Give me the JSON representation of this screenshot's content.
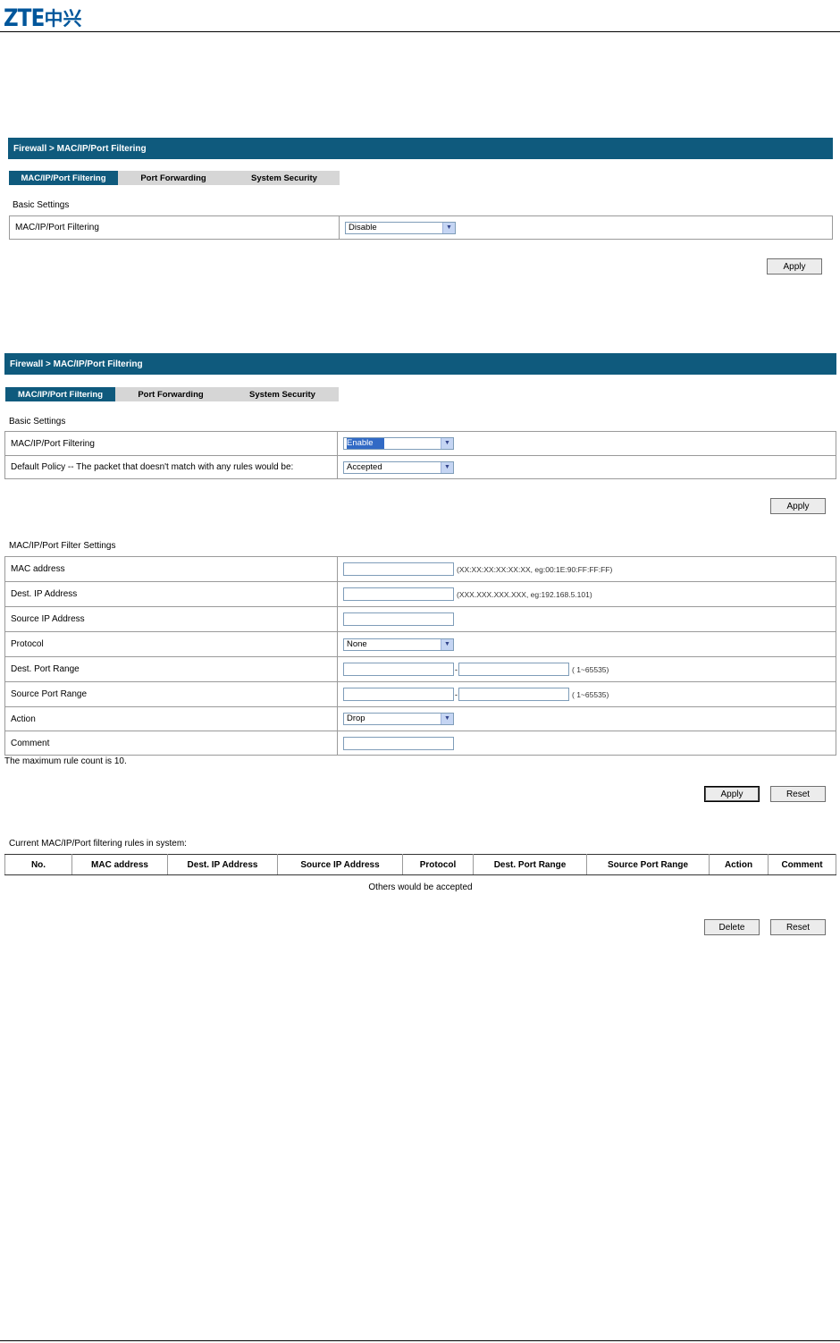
{
  "header": {
    "logo_latin": "ZTE",
    "logo_cn": "中兴"
  },
  "screen1": {
    "title": "Firewall > MAC/IP/Port Filtering",
    "tabs": [
      "MAC/IP/Port Filtering",
      "Port Forwarding",
      "System Security"
    ],
    "basic_settings": "Basic Settings",
    "filtering_label": "MAC/IP/Port Filtering",
    "filtering_value": "Disable",
    "apply": "Apply"
  },
  "screen2": {
    "title": "Firewall > MAC/IP/Port Filtering",
    "tabs": [
      "MAC/IP/Port Filtering",
      "Port Forwarding",
      "System Security"
    ],
    "basic_settings": "Basic Settings",
    "filtering_label": "MAC/IP/Port Filtering",
    "filtering_value": "Enable",
    "policy_label": "Default Policy -- The packet that doesn't match with any rules would be:",
    "policy_value": "Accepted",
    "apply": "Apply",
    "filter_settings": "MAC/IP/Port Filter Settings",
    "fields": {
      "mac": "MAC address",
      "mac_hint": "(XX:XX:XX:XX:XX:XX, eg:00:1E:90:FF:FF:FF)",
      "dest_ip": "Dest. IP Address",
      "dest_ip_hint": "(XXX.XXX.XXX.XXX, eg:192.168.5.101)",
      "src_ip": "Source IP Address",
      "protocol": "Protocol",
      "protocol_value": "None",
      "dest_port": "Dest. Port Range",
      "dest_port_hint": "( 1~65535)",
      "src_port": "Source Port Range",
      "src_port_hint": "( 1~65535)",
      "action": "Action",
      "action_value": "Drop",
      "comment": "Comment",
      "dash": "-"
    },
    "max_rule_note": "The maximum rule count is 10.",
    "apply2": "Apply",
    "reset": "Reset",
    "rules_title": "Current MAC/IP/Port filtering rules in system:",
    "rules_columns": [
      "No.",
      "MAC address",
      "Dest. IP Address",
      "Source IP Address",
      "Protocol",
      "Dest. Port Range",
      "Source Port Range",
      "Action",
      "Comment"
    ],
    "rules_footer": "Others would be accepted",
    "delete": "Delete",
    "reset2": "Reset"
  }
}
